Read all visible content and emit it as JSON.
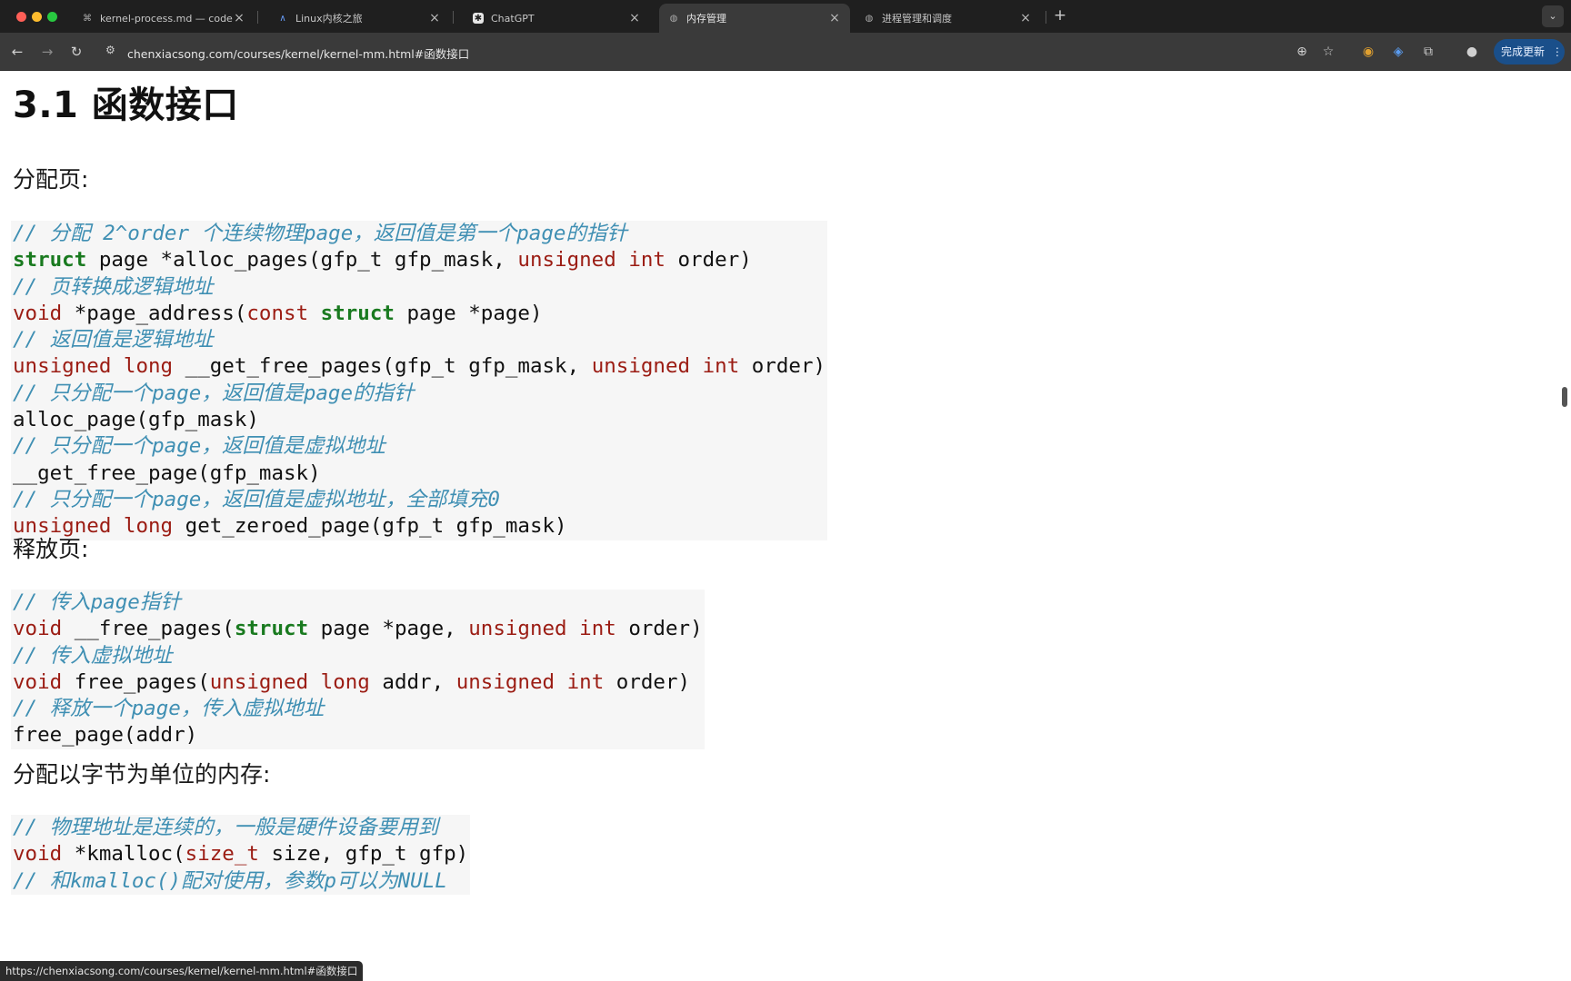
{
  "browser": {
    "tabs": [
      {
        "title": "kernel-process.md — code —",
        "icon": "vscode-icon",
        "active": false
      },
      {
        "title": "Linux内核之旅",
        "icon": "feather-icon",
        "active": false
      },
      {
        "title": "ChatGPT",
        "icon": "chatgpt-icon",
        "active": false
      },
      {
        "title": "内存管理",
        "icon": "globe-icon",
        "active": true
      },
      {
        "title": "进程管理和调度",
        "icon": "globe-icon",
        "active": false
      }
    ],
    "url": "chenxiacsong.com/courses/kernel/kernel-mm.html#函数接口",
    "update_button_label": "完成更新",
    "status_url": "https://chenxiacsong.com/courses/kernel/kernel-mm.html#函数接口"
  },
  "page": {
    "heading": "3.1 函数接口",
    "sections": [
      {
        "title": "分配页:",
        "code": [
          [
            [
              "cm",
              "// 分配 2^order 个连续物理page，返回值是第一个page的指针"
            ]
          ],
          [
            [
              "kg",
              "struct"
            ],
            [
              "tx",
              " page *alloc_pages(gfp_t gfp_mask, "
            ],
            [
              "kw",
              "unsigned"
            ],
            [
              "tx",
              " "
            ],
            [
              "kw",
              "int"
            ],
            [
              "tx",
              " order)"
            ]
          ],
          [
            [
              "cm",
              "// 页转换成逻辑地址"
            ]
          ],
          [
            [
              "kw",
              "void"
            ],
            [
              "tx",
              " *page_address("
            ],
            [
              "kw",
              "const"
            ],
            [
              "tx",
              " "
            ],
            [
              "kg",
              "struct"
            ],
            [
              "tx",
              " page *page)"
            ]
          ],
          [
            [
              "cm",
              "// 返回值是逻辑地址"
            ]
          ],
          [
            [
              "kw",
              "unsigned"
            ],
            [
              "tx",
              " "
            ],
            [
              "kw",
              "long"
            ],
            [
              "tx",
              " __get_free_pages(gfp_t gfp_mask, "
            ],
            [
              "kw",
              "unsigned"
            ],
            [
              "tx",
              " "
            ],
            [
              "kw",
              "int"
            ],
            [
              "tx",
              " order)"
            ]
          ],
          [
            [
              "cm",
              "// 只分配一个page，返回值是page的指针"
            ]
          ],
          [
            [
              "tx",
              "alloc_page(gfp_mask)"
            ]
          ],
          [
            [
              "cm",
              "// 只分配一个page，返回值是虚拟地址"
            ]
          ],
          [
            [
              "tx",
              "__get_free_page(gfp_mask)"
            ]
          ],
          [
            [
              "cm",
              "// 只分配一个page，返回值是虚拟地址，全部填充0"
            ]
          ],
          [
            [
              "kw",
              "unsigned"
            ],
            [
              "tx",
              " "
            ],
            [
              "kw",
              "long"
            ],
            [
              "tx",
              " get_zeroed_page(gfp_t gfp_mask)"
            ]
          ]
        ]
      },
      {
        "title": "释放页:",
        "code": [
          [
            [
              "cm",
              "// 传入page指针"
            ]
          ],
          [
            [
              "kw",
              "void"
            ],
            [
              "tx",
              " __free_pages("
            ],
            [
              "kg",
              "struct"
            ],
            [
              "tx",
              " page *page, "
            ],
            [
              "kw",
              "unsigned"
            ],
            [
              "tx",
              " "
            ],
            [
              "kw",
              "int"
            ],
            [
              "tx",
              " order)"
            ]
          ],
          [
            [
              "cm",
              "// 传入虚拟地址"
            ]
          ],
          [
            [
              "kw",
              "void"
            ],
            [
              "tx",
              " free_pages("
            ],
            [
              "kw",
              "unsigned"
            ],
            [
              "tx",
              " "
            ],
            [
              "kw",
              "long"
            ],
            [
              "tx",
              " addr, "
            ],
            [
              "kw",
              "unsigned"
            ],
            [
              "tx",
              " "
            ],
            [
              "kw",
              "int"
            ],
            [
              "tx",
              " order)"
            ]
          ],
          [
            [
              "cm",
              "// 释放一个page，传入虚拟地址"
            ]
          ],
          [
            [
              "tx",
              "free_page(addr)"
            ]
          ]
        ]
      },
      {
        "title": "分配以字节为单位的内存:",
        "code": [
          [
            [
              "cm",
              "// 物理地址是连续的，一般是硬件设备要用到"
            ]
          ],
          [
            [
              "kw",
              "void"
            ],
            [
              "tx",
              " *kmalloc("
            ],
            [
              "kw",
              "size_t"
            ],
            [
              "tx",
              " size, gfp_t gfp)"
            ]
          ],
          [
            [
              "cm",
              "// 和kmalloc()配对使用，参数p可以为NULL"
            ]
          ]
        ]
      }
    ]
  }
}
